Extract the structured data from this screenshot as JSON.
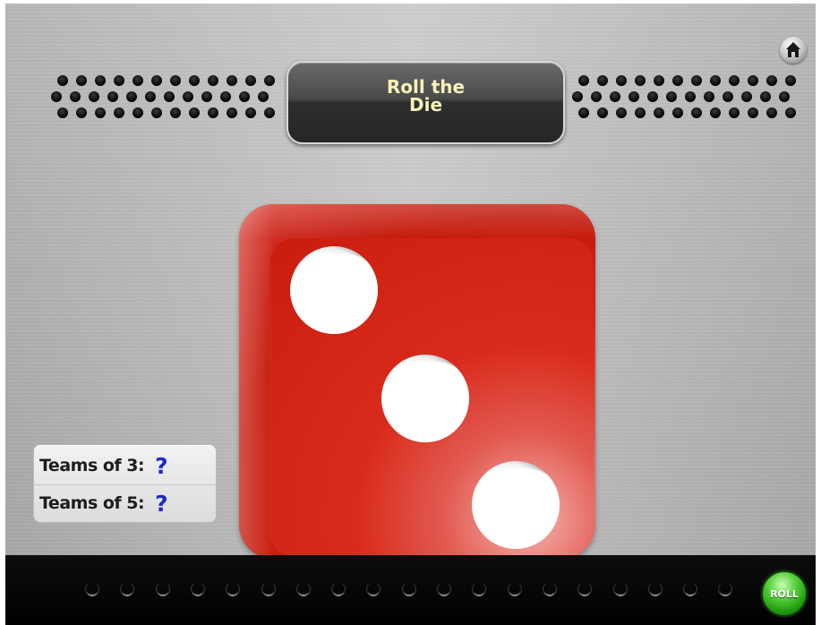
{
  "title": {
    "text": "Roll the Die"
  },
  "home": {
    "icon": "home-icon"
  },
  "die": {
    "value": 3,
    "color": "#d32315",
    "pip_color": "#ffffff"
  },
  "teams": [
    {
      "label": "Teams of 3:",
      "answer": "?"
    },
    {
      "label": "Teams of 5:",
      "answer": "?"
    }
  ],
  "roll_button": {
    "label": "ROLL",
    "color": "#2fae1c"
  },
  "colors": {
    "title_text": "#f7f2b7",
    "answer": "#1b2cc6",
    "bottom_bar": "#000000"
  }
}
